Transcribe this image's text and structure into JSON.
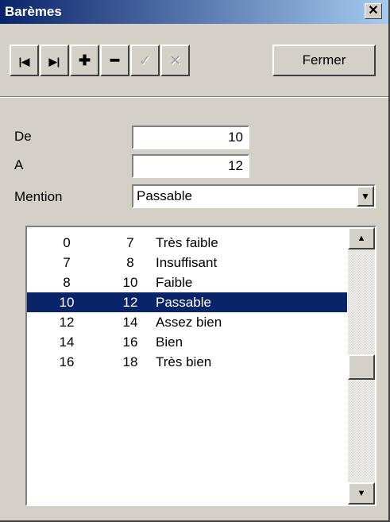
{
  "window": {
    "title": "Barèmes",
    "close_glyph": "✕"
  },
  "toolbar": {
    "buttons": [
      {
        "icon": "first-record-icon",
        "glyph": "|◀"
      },
      {
        "icon": "last-record-icon",
        "glyph": "▶|"
      },
      {
        "icon": "add-icon",
        "glyph": "✚"
      },
      {
        "icon": "remove-icon",
        "glyph": "━"
      },
      {
        "icon": "confirm-icon",
        "glyph": "✓"
      },
      {
        "icon": "cancel-icon",
        "glyph": "✕"
      }
    ],
    "close_label": "Fermer"
  },
  "form": {
    "de_label": "De",
    "de_value": "10",
    "a_label": "A",
    "a_value": "12",
    "mention_label": "Mention",
    "mention_value": "Passable"
  },
  "list": {
    "rows": [
      {
        "from": "0",
        "to": "7",
        "mention": "Très faible"
      },
      {
        "from": "7",
        "to": "8",
        "mention": "Insuffisant"
      },
      {
        "from": "8",
        "to": "10",
        "mention": "Faible"
      },
      {
        "from": "10",
        "to": "12",
        "mention": "Passable"
      },
      {
        "from": "12",
        "to": "14",
        "mention": "Assez bien"
      },
      {
        "from": "14",
        "to": "16",
        "mention": "Bien"
      },
      {
        "from": "16",
        "to": "18",
        "mention": "Très bien"
      }
    ],
    "selected_index": 3
  },
  "colors": {
    "title_start": "#0a246a",
    "title_end": "#a6caf0",
    "selection": "#0a246a",
    "face": "#d4d0c8"
  }
}
